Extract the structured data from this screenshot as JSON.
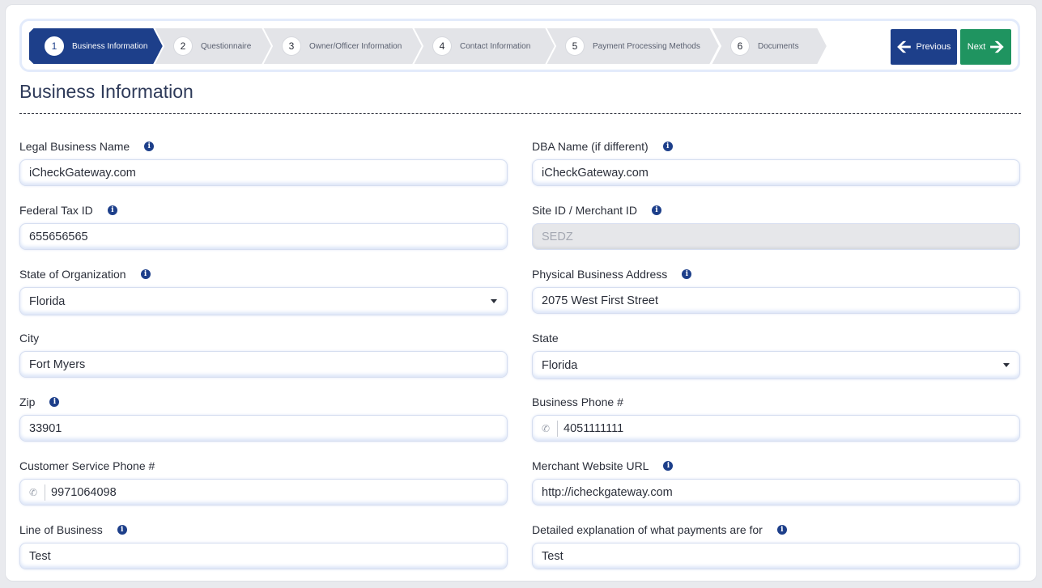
{
  "wizard": {
    "steps": [
      {
        "num": "1",
        "label": "Business Information"
      },
      {
        "num": "2",
        "label": "Questionnaire"
      },
      {
        "num": "3",
        "label": "Owner/Officer Information"
      },
      {
        "num": "4",
        "label": "Contact Information"
      },
      {
        "num": "5",
        "label": "Payment Processing Methods"
      },
      {
        "num": "6",
        "label": "Documents"
      }
    ],
    "previous_label": "Previous",
    "next_label": "Next"
  },
  "page_title": "Business Information",
  "fields": {
    "legal_business_name": {
      "label": "Legal Business Name",
      "value": "iCheckGateway.com"
    },
    "dba_name": {
      "label": "DBA Name (if different)",
      "value": "iCheckGateway.com"
    },
    "federal_tax_id": {
      "label": "Federal Tax ID",
      "value": "655656565"
    },
    "site_id": {
      "label": "Site ID / Merchant ID",
      "value": "SEDZ"
    },
    "state_of_org": {
      "label": "State of Organization",
      "value": "Florida"
    },
    "physical_address": {
      "label": "Physical Business Address",
      "value": "2075 West First Street"
    },
    "city": {
      "label": "City",
      "value": "Fort Myers"
    },
    "state": {
      "label": "State",
      "value": "Florida"
    },
    "zip": {
      "label": "Zip",
      "value": "33901"
    },
    "business_phone": {
      "label": "Business Phone #",
      "value": "4051111111"
    },
    "cs_phone": {
      "label": "Customer Service Phone #",
      "value": "9971064098"
    },
    "website_url": {
      "label": "Merchant Website URL",
      "value": "http://icheckgateway.com"
    },
    "line_of_business": {
      "label": "Line of Business",
      "value": "Test"
    },
    "payment_explanation": {
      "label": "Detailed explanation of what payments are for",
      "value": "Test"
    }
  },
  "icons": {
    "info": "info-icon",
    "phone": "phone-icon",
    "caret": "chevron-down-icon",
    "arrow_left": "arrow-left-icon",
    "arrow_right": "arrow-right-icon"
  },
  "colors": {
    "primary": "#1d3f8a",
    "success": "#1f9460",
    "step_inactive": "#e3e4e8"
  }
}
